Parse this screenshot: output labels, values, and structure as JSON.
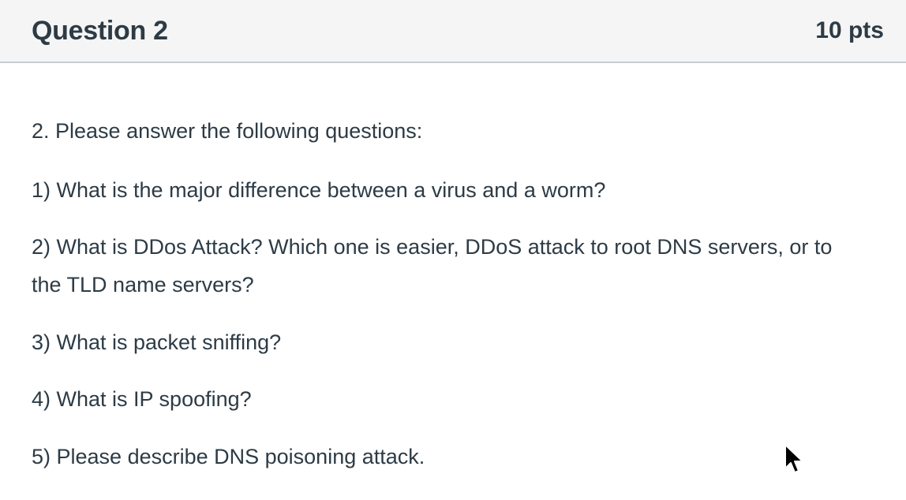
{
  "header": {
    "title": "Question 2",
    "points": "10 pts"
  },
  "body": {
    "intro": "2. Please answer the following questions:",
    "items": [
      "1) What is the major difference between a virus and a worm?",
      "2) What is DDos Attack? Which one is easier, DDoS attack to root DNS servers, or to the TLD name servers?",
      "3) What is packet sniffing?",
      "4) What is IP spoofing?",
      "5) Please describe DNS poisoning attack."
    ]
  },
  "cursor": {
    "icon": "mouse-pointer-icon"
  }
}
